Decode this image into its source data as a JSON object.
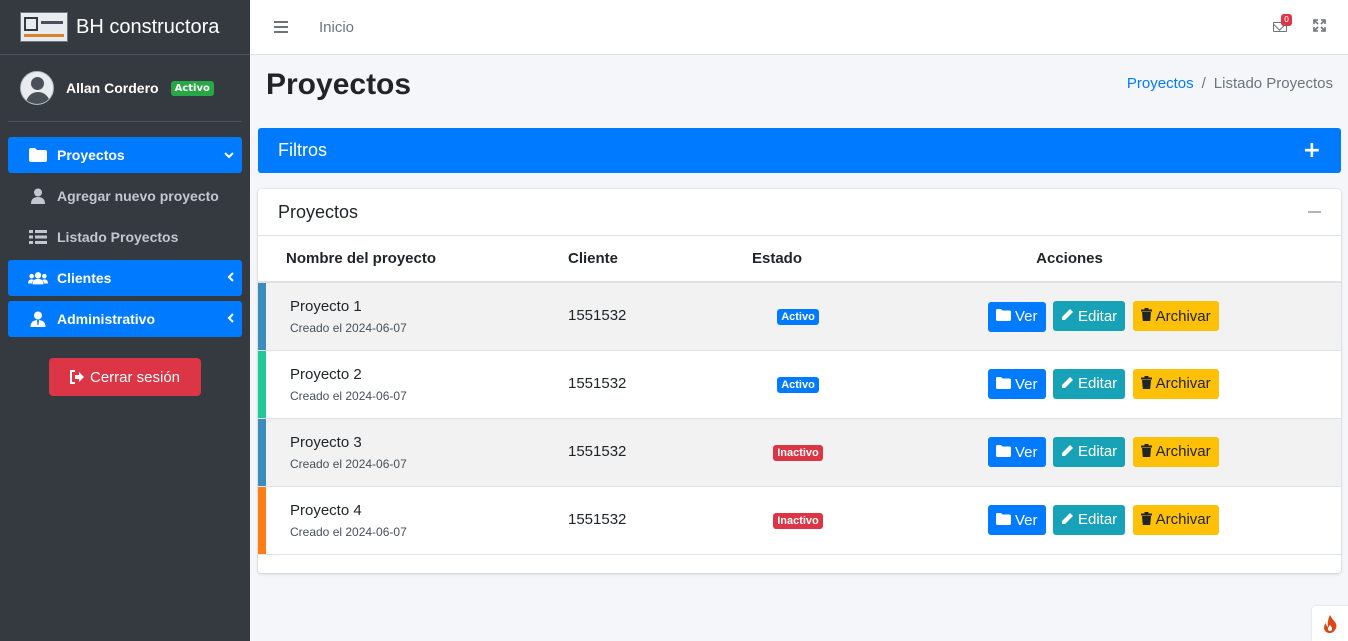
{
  "brand": {
    "title": "BH constructora"
  },
  "user": {
    "name": "Allan Cordero",
    "status": "Activo"
  },
  "sidebar": {
    "items": [
      {
        "label": "Proyectos",
        "icon": "folder-icon",
        "chevron": "⌄"
      },
      {
        "label": "Agregar nuevo proyecto",
        "icon": "user-icon"
      },
      {
        "label": "Listado Proyectos",
        "icon": "list-icon"
      },
      {
        "label": "Clientes",
        "icon": "users-icon",
        "chevron": "‹"
      },
      {
        "label": "Administrativo",
        "icon": "user-tie-icon",
        "chevron": "‹"
      }
    ],
    "logout": "Cerrar sesión"
  },
  "header": {
    "home": "Inicio",
    "mail_count": "0"
  },
  "page": {
    "title": "Proyectos",
    "breadcrumb": {
      "link": "Proyectos",
      "sep": "/",
      "current": "Listado Proyectos"
    }
  },
  "filters": {
    "title": "Filtros",
    "toggle": "+"
  },
  "card": {
    "title": "Proyectos",
    "columns": {
      "name": "Nombre del proyecto",
      "client": "Cliente",
      "status": "Estado",
      "actions": "Acciones"
    },
    "buttons": {
      "view": "Ver",
      "edit": "Editar",
      "archive": "Archivar"
    },
    "rows": [
      {
        "name": "Proyecto 1",
        "date": "Creado el 2024-06-07",
        "client": "1551532",
        "status": "Activo",
        "accent": "#3c8dbc"
      },
      {
        "name": "Proyecto 2",
        "date": "Creado el 2024-06-07",
        "client": "1551532",
        "status": "Activo",
        "accent": "#20c997"
      },
      {
        "name": "Proyecto 3",
        "date": "Creado el 2024-06-07",
        "client": "1551532",
        "status": "Inactivo",
        "accent": "#3c8dbc"
      },
      {
        "name": "Proyecto 4",
        "date": "Creado el 2024-06-07",
        "client": "1551532",
        "status": "Inactivo",
        "accent": "#fd7e14"
      }
    ]
  },
  "colors": {
    "primary": "#007bff",
    "success": "#28a745",
    "danger": "#dc3545",
    "info": "#17a2b8",
    "warning": "#ffc107",
    "sidebar": "#343a40"
  }
}
